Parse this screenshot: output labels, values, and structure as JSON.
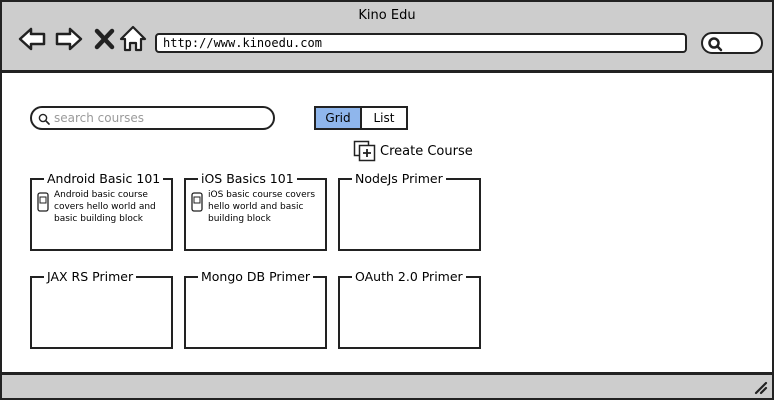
{
  "window": {
    "title": "Kino Edu"
  },
  "browser": {
    "url": "http://www.kinoedu.com",
    "icons": [
      "back-arrow-icon",
      "forward-arrow-icon",
      "close-icon",
      "home-icon",
      "search-icon"
    ]
  },
  "toolbar": {
    "search_placeholder": "search courses",
    "view_toggle": {
      "options": [
        "Grid",
        "List"
      ],
      "selected": "Grid"
    },
    "create_label": "Create Course"
  },
  "colors": {
    "active_toggle": "#8fb6ec",
    "chrome": "#cdcdcd"
  },
  "courses": [
    {
      "title": "Android Basic 101",
      "icon": "phone-icon",
      "desc": "Android basic course covers hello world and basic building block"
    },
    {
      "title": "iOS Basics 101",
      "icon": "phone-icon",
      "desc": "iOS basic course covers hello world and basic building block"
    },
    {
      "title": "NodeJs Primer"
    },
    {
      "title": "JAX RS Primer"
    },
    {
      "title": "Mongo DB Primer"
    },
    {
      "title": "OAuth 2.0 Primer"
    }
  ]
}
